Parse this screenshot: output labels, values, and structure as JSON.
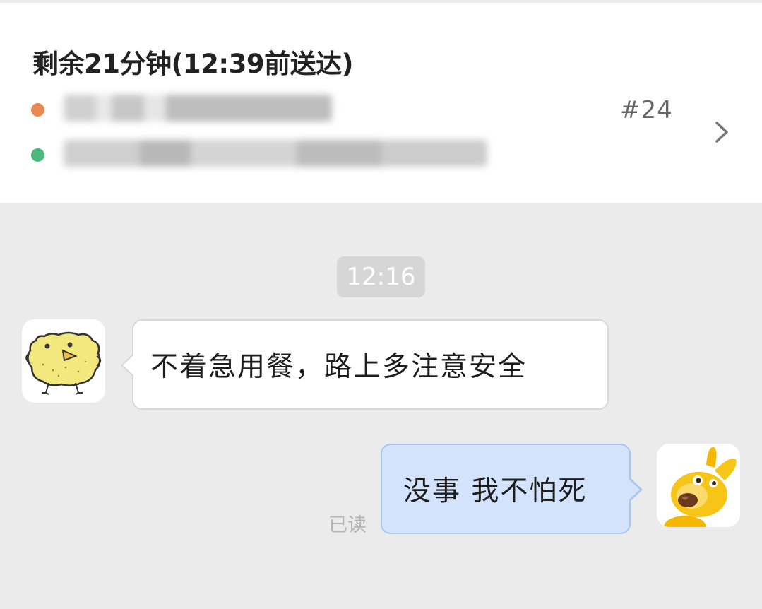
{
  "order": {
    "eta_title": "剩余21分钟(12:39前送达)",
    "order_number": "#24",
    "pickup": {
      "dot_color": "#e8894f",
      "address": ""
    },
    "dropoff": {
      "dot_color": "#4cb97c",
      "address": ""
    },
    "chevron_icon": "chevron-right-icon"
  },
  "chat": {
    "timestamp": "12:16",
    "messages": [
      {
        "direction": "incoming",
        "text": "不着急用餐，路上多注意安全",
        "avatar_icon": "yellow-chick-avatar"
      },
      {
        "direction": "outgoing",
        "text": "没事 我不怕死",
        "avatar_icon": "yellow-dog-avatar",
        "status": "已读"
      }
    ]
  },
  "colors": {
    "chat_background": "#ebebeb",
    "outgoing_bubble": "#d2e3fb",
    "incoming_bubble": "#ffffff"
  }
}
